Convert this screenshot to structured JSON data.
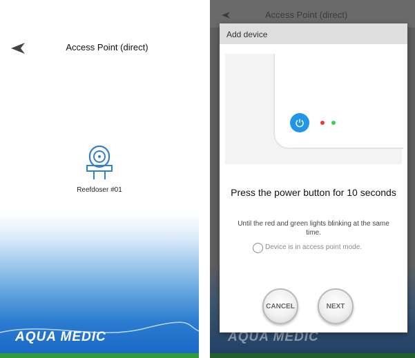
{
  "left_screen": {
    "title": "Access Point (direct)",
    "device": {
      "label": "Reefdoser #01",
      "icon": "doser-pump-icon"
    },
    "brand": "AQUA MEDIC",
    "colors": {
      "icon_stroke": "#2d7fd6",
      "footer_blue": "#1868c4",
      "bottom_bar": "#2e9a3a"
    }
  },
  "right_screen": {
    "background_title": "Access Point (direct)",
    "dialog": {
      "title": "Add device",
      "instruction_title": "Press the power button for 10 seconds",
      "instruction_sub": "Until the red and green lights blinking at the same time.",
      "checkbox_label": "Device is in access point mode.",
      "checkbox_checked": false,
      "buttons": {
        "cancel": "CANCEL",
        "next": "NEXT"
      }
    },
    "brand": "AQUA MEDIC",
    "colors": {
      "power_button": "#2196e8",
      "led_red": "#e63b3b",
      "led_green": "#3fcf4e"
    }
  }
}
